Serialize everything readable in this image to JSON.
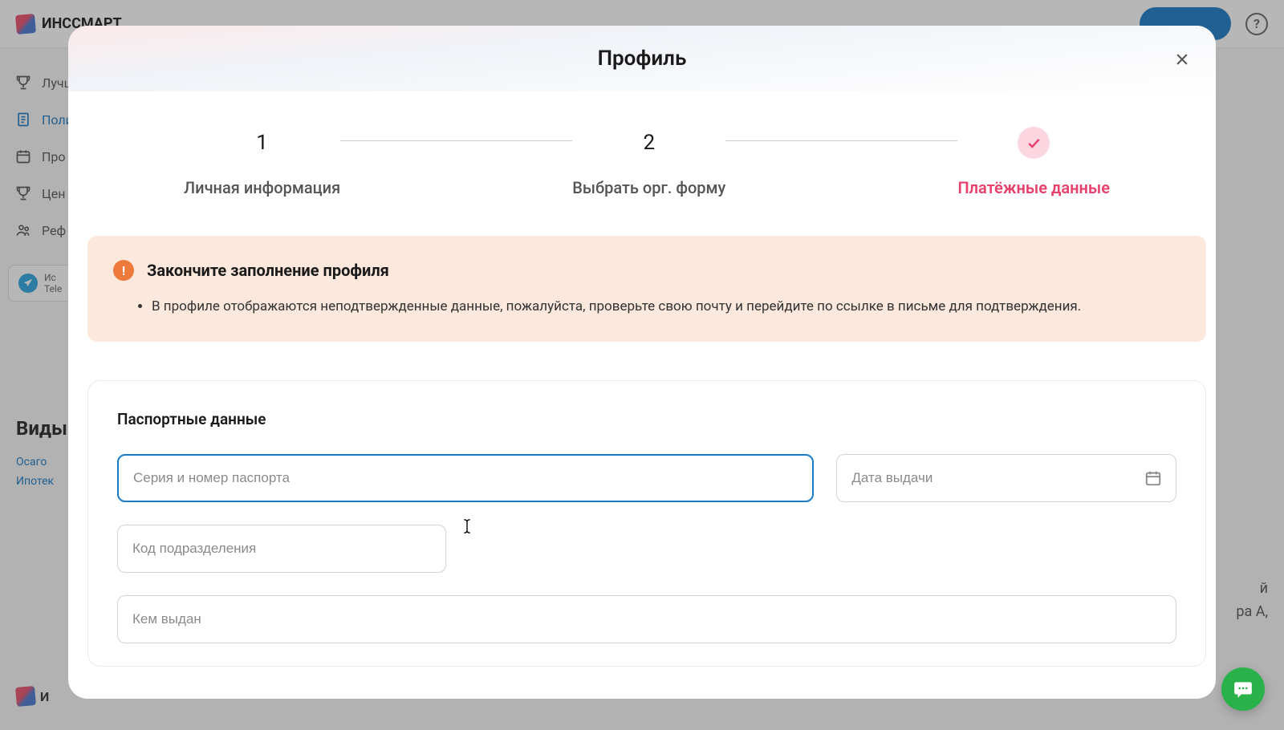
{
  "header": {
    "brand": "ИНССМАРТ"
  },
  "sidebar": {
    "items": [
      {
        "label": "Лучш"
      },
      {
        "label": "Поли"
      },
      {
        "label": "Про"
      },
      {
        "label": "Цен"
      },
      {
        "label": "Реф"
      }
    ],
    "telegram_line1": "Ис",
    "telegram_line2": "Tele"
  },
  "main": {
    "heading": "Виды",
    "links": [
      "Осаго",
      "Ипотек"
    ]
  },
  "bg_right": {
    "line1": "й",
    "line2": "ра А,"
  },
  "modal": {
    "title": "Профиль",
    "steps": [
      {
        "num": "1",
        "label": "Личная информация"
      },
      {
        "num": "2",
        "label": "Выбрать орг. форму"
      },
      {
        "num": "✓",
        "label": "Платёжные данные"
      }
    ],
    "warning": {
      "title": "Закончите заполнение профиля",
      "item": "В профиле отображаются неподтвержденные данные, пожалуйста, проверьте свою почту и перейдите по ссылке в письме для подтверждения."
    },
    "form": {
      "section_title": "Паспортные данные",
      "passport_placeholder": "Серия и номер паспорта",
      "date_placeholder": "Дата выдачи",
      "code_placeholder": "Код подразделения",
      "issued_placeholder": "Кем выдан"
    }
  }
}
